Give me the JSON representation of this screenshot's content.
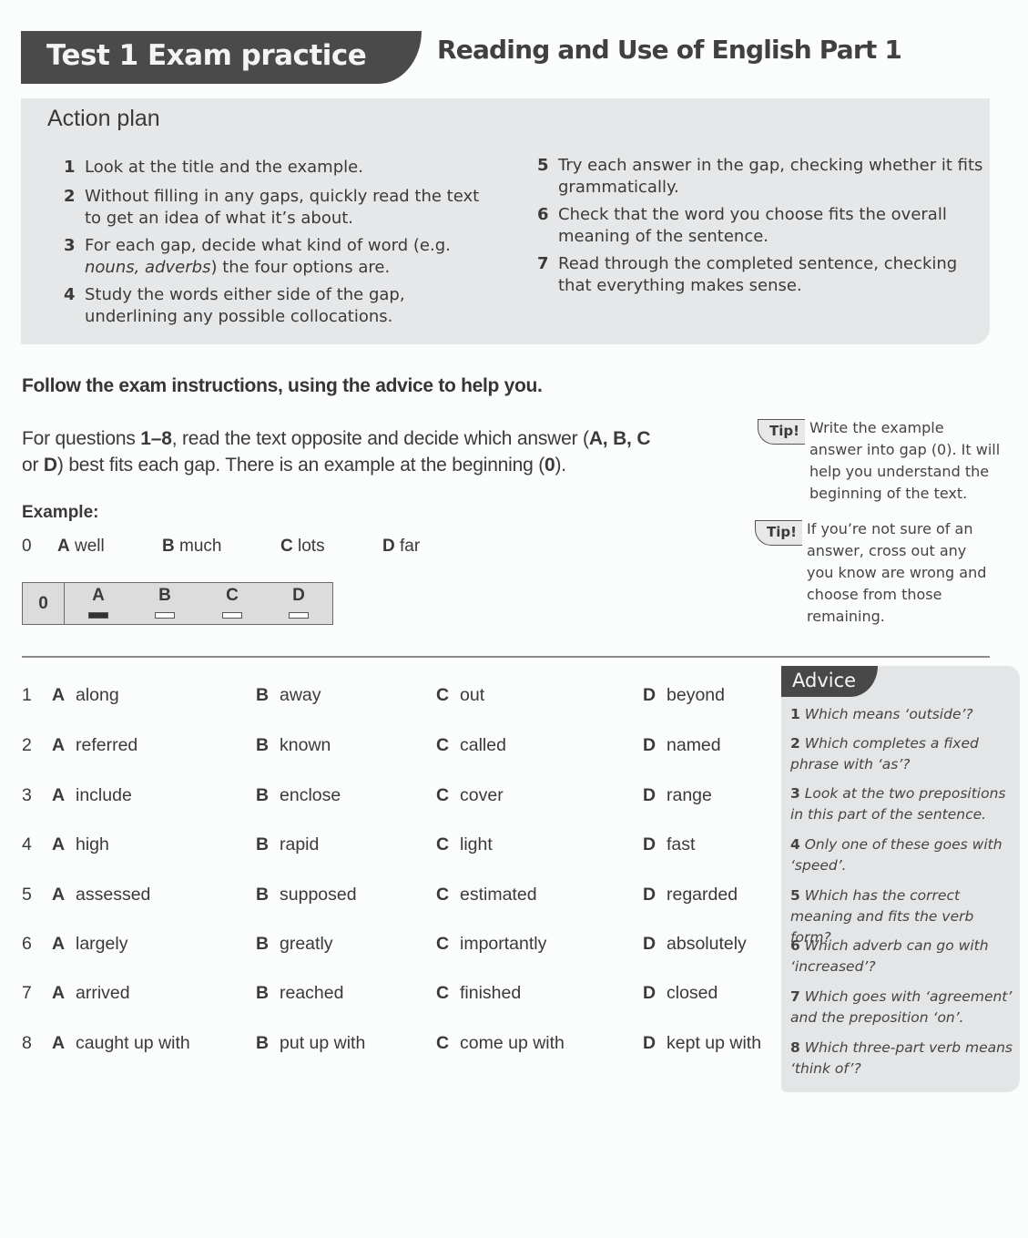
{
  "header": {
    "tab_title": "Test 1  Exam practice",
    "section_title": "Reading and Use of English Part 1"
  },
  "action_plan": {
    "title": "Action plan",
    "items": [
      {
        "num": "1",
        "text": "Look at the title and the example."
      },
      {
        "num": "2",
        "text": "Without filling in any gaps, quickly read the text to get an idea of what it’s about."
      },
      {
        "num": "3",
        "text_before": "For each gap, decide what kind of word (e.g. ",
        "text_italic": "nouns, adverbs",
        "text_after": ") the four options are."
      },
      {
        "num": "4",
        "text": "Study the words either side of the gap, underlining any possible collocations."
      },
      {
        "num": "5",
        "text": "Try each answer in the gap, checking whether it fits grammatically."
      },
      {
        "num": "6",
        "text": "Check that the word you choose fits the overall meaning of the sentence."
      },
      {
        "num": "7",
        "text": "Read through the completed sentence, checking that everything makes sense."
      }
    ]
  },
  "instructions": {
    "heading": "Follow the exam instructions, using the advice to help you.",
    "p1": "For questions ",
    "p1_bold": "1–8",
    "p2": ", read the text opposite and decide which answer (",
    "p2_bold": "A, B, C",
    "p3": "or ",
    "p3_bold": "D",
    "p4": ") best fits each gap. There is an example at the beginning (",
    "p4_bold": "0",
    "p5": ")."
  },
  "example": {
    "label": "Example:",
    "num": "0",
    "options": [
      {
        "letter": "A",
        "word": "well"
      },
      {
        "letter": "B",
        "word": "much"
      },
      {
        "letter": "C",
        "word": "lots"
      },
      {
        "letter": "D",
        "word": "far"
      }
    ],
    "answer_sheet": {
      "num": "0",
      "letters": [
        "A",
        "B",
        "C",
        "D"
      ],
      "selected": "A"
    }
  },
  "tips": [
    {
      "badge": "Tip!",
      "text": "Write the example answer into gap (0). It will help you understand the beginning of the text."
    },
    {
      "badge": "Tip!",
      "text": "If you’re not sure of an answer, cross out any you know are wrong and choose from those remaining."
    }
  ],
  "questions": [
    {
      "num": "1",
      "options": [
        "along",
        "away",
        "out",
        "beyond"
      ]
    },
    {
      "num": "2",
      "options": [
        "referred",
        "known",
        "called",
        "named"
      ]
    },
    {
      "num": "3",
      "options": [
        "include",
        "enclose",
        "cover",
        "range"
      ]
    },
    {
      "num": "4",
      "options": [
        "high",
        "rapid",
        "light",
        "fast"
      ]
    },
    {
      "num": "5",
      "options": [
        "assessed",
        "supposed",
        "estimated",
        "regarded"
      ]
    },
    {
      "num": "6",
      "options": [
        "largely",
        "greatly",
        "importantly",
        "absolutely"
      ]
    },
    {
      "num": "7",
      "options": [
        "arrived",
        "reached",
        "finished",
        "closed"
      ]
    },
    {
      "num": "8",
      "options": [
        "caught up with",
        "put up with",
        "come up with",
        "kept up with"
      ]
    }
  ],
  "option_letters": [
    "A",
    "B",
    "C",
    "D"
  ],
  "advice": {
    "title": "Advice",
    "items": [
      {
        "num": "1",
        "text": "Which means ‘outside’?"
      },
      {
        "num": "2",
        "text": "Which completes a fixed phrase with ‘as’?"
      },
      {
        "num": "3",
        "text": "Look at the two prepositions in this part of the sentence."
      },
      {
        "num": "4",
        "text": "Only one of these goes with ‘speed’."
      },
      {
        "num": "5",
        "text": "Which has the correct meaning and fits the verb form?"
      },
      {
        "num": "6",
        "text": "Which adverb can go with ‘increased’?"
      },
      {
        "num": "7",
        "text": "Which goes with ‘agreement’ and the preposition ‘on’."
      },
      {
        "num": "8",
        "text": "Which three-part verb means ‘think of’?"
      }
    ]
  }
}
